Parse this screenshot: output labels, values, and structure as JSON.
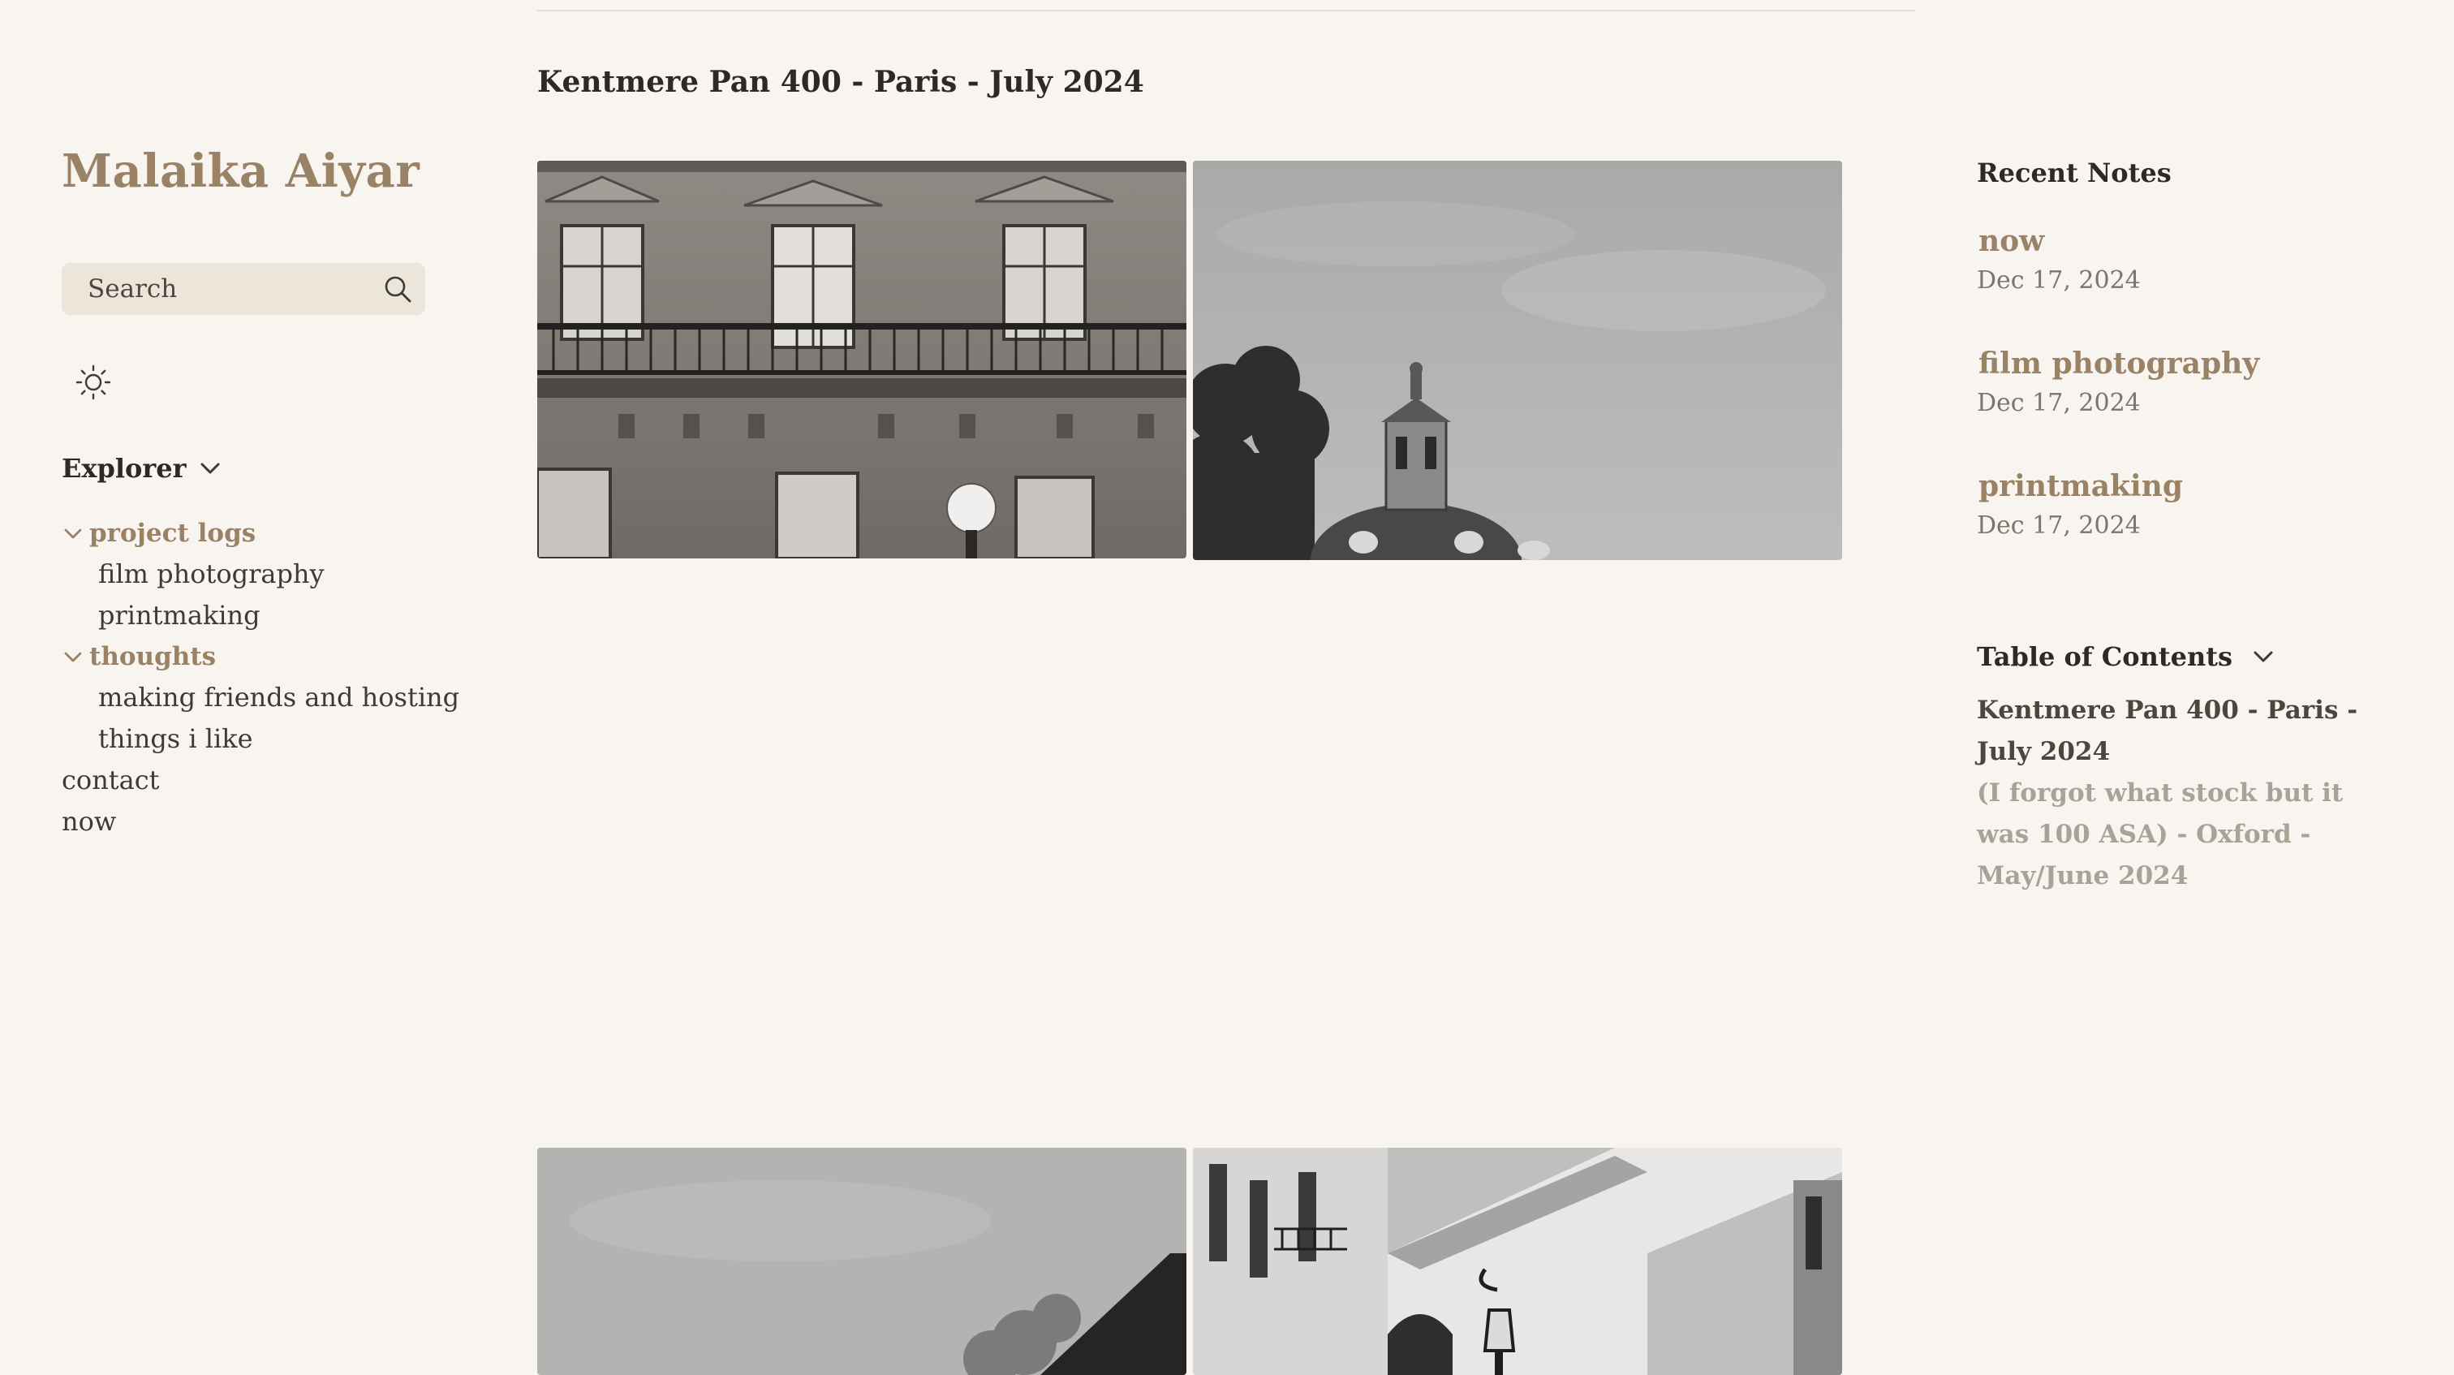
{
  "sidebar": {
    "site_title": "Malaika Aiyar",
    "search_label": "Search",
    "explorer_label": "Explorer",
    "tree": {
      "folder1": "project logs",
      "folder1_items": [
        "film photography",
        "printmaking"
      ],
      "folder2": "thoughts",
      "folder2_items": [
        "making friends and hosting",
        "things i like"
      ],
      "root_items": [
        "contact",
        "now"
      ]
    }
  },
  "main": {
    "heading": "Kentmere Pan 400 - Paris - July 2024"
  },
  "right": {
    "recent_title": "Recent Notes",
    "notes": [
      {
        "title": "now",
        "date": "Dec 17, 2024"
      },
      {
        "title": "film photography",
        "date": "Dec 17, 2024"
      },
      {
        "title": "printmaking",
        "date": "Dec 17, 2024"
      }
    ],
    "toc_title": "Table of Contents",
    "toc": [
      "Kentmere Pan 400 - Paris - July 2024",
      "(I forgot what stock but it was 100 ASA) - Oxford - May/June 2024"
    ]
  },
  "colors": {
    "background": "#f8f5f0",
    "accent": "#9a8267",
    "search_bg": "#ece5da"
  },
  "icons": {
    "search": "search-icon",
    "theme": "sun-icon",
    "chevron": "chevron-down-icon"
  }
}
